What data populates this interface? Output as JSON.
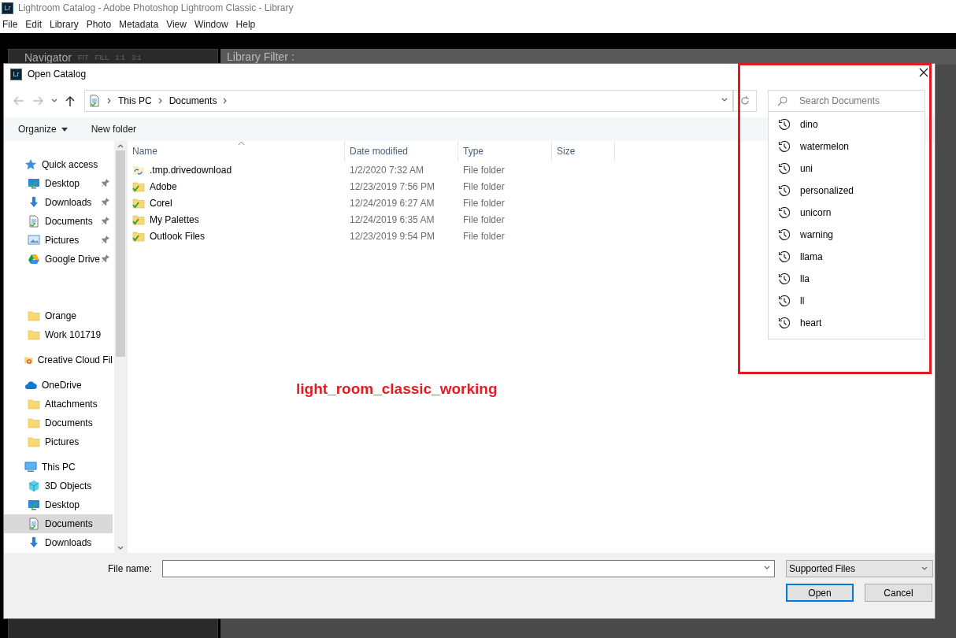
{
  "app_window": {
    "title": "Lightroom Catalog - Adobe Photoshop Lightroom Classic - Library",
    "icon_text": "Lr"
  },
  "menu": [
    "File",
    "Edit",
    "Library",
    "Photo",
    "Metadata",
    "View",
    "Window",
    "Help"
  ],
  "background_panels": {
    "navigator": {
      "title": "Navigator",
      "options": [
        "FIT",
        "FILL",
        "1:1",
        "3:1"
      ]
    },
    "library_filter": {
      "title": "Library Filter :"
    }
  },
  "dialog": {
    "title": "Open Catalog",
    "icon_text": "Lr",
    "breadcrumb": [
      "This PC",
      "Documents"
    ],
    "search": {
      "placeholder": "Search Documents"
    },
    "search_history": [
      "dino",
      "watermelon",
      "uni",
      "personalized",
      "unicorn",
      "warning",
      "llama",
      "lla",
      "ll",
      "heart"
    ],
    "toolbar": {
      "organize": "Organize",
      "new_folder": "New folder"
    },
    "nav_pane": [
      {
        "label": "Quick access",
        "kind": "star",
        "selected": false,
        "children": [
          {
            "label": "Desktop",
            "kind": "desktop",
            "pinned": true,
            "selected": false
          },
          {
            "label": "Downloads",
            "kind": "download",
            "pinned": true,
            "selected": false
          },
          {
            "label": "Documents",
            "kind": "documents",
            "pinned": true,
            "selected": false
          },
          {
            "label": "Pictures",
            "kind": "pictures",
            "pinned": true,
            "selected": false
          },
          {
            "label": "Google Drive",
            "kind": "gdrive",
            "pinned": true,
            "selected": false
          },
          {
            "label": "Orange",
            "kind": "folder",
            "pinned": false,
            "selected": false
          },
          {
            "label": "Work 101719",
            "kind": "folder",
            "pinned": false,
            "selected": false
          }
        ]
      },
      {
        "label": "Creative Cloud Fil",
        "kind": "cc",
        "selected": false
      },
      {
        "label": "OneDrive",
        "kind": "cloud",
        "selected": false,
        "children": [
          {
            "label": "Attachments",
            "kind": "folder",
            "pinned": false,
            "selected": false
          },
          {
            "label": "Documents",
            "kind": "folder",
            "pinned": false,
            "selected": false
          },
          {
            "label": "Pictures",
            "kind": "folder",
            "pinned": false,
            "selected": false
          }
        ]
      },
      {
        "label": "This PC",
        "kind": "pc",
        "selected": false,
        "children": [
          {
            "label": "3D Objects",
            "kind": "cube",
            "pinned": false,
            "selected": false
          },
          {
            "label": "Desktop",
            "kind": "desktop",
            "pinned": false,
            "selected": false
          },
          {
            "label": "Documents",
            "kind": "documents",
            "pinned": false,
            "selected": true
          },
          {
            "label": "Downloads",
            "kind": "download",
            "pinned": false,
            "selected": false
          }
        ]
      }
    ],
    "file_list": {
      "columns": [
        "Name",
        "Date modified",
        "Type",
        "Size"
      ],
      "rows": [
        {
          "name": ".tmp.drivedownload",
          "kind": "sync",
          "date_modified": "1/2/2020 7:32 AM",
          "type": "File folder"
        },
        {
          "name": "Adobe",
          "kind": "synced",
          "date_modified": "12/23/2019 7:56 PM",
          "type": "File folder"
        },
        {
          "name": "Corel",
          "kind": "synced",
          "date_modified": "12/24/2019 6:27 AM",
          "type": "File folder"
        },
        {
          "name": "My Palettes",
          "kind": "synced",
          "date_modified": "12/24/2019 6:35 AM",
          "type": "File folder"
        },
        {
          "name": "Outlook Files",
          "kind": "synced",
          "date_modified": "12/23/2019 9:54 PM",
          "type": "File folder"
        }
      ]
    },
    "file_name_label": "File name:",
    "file_type_filter": "Supported Files",
    "buttons": [
      {
        "label": "Open",
        "default": true
      },
      {
        "label": "Cancel",
        "default": false
      }
    ]
  },
  "annotation": {
    "label": "light_room_classic_working"
  }
}
